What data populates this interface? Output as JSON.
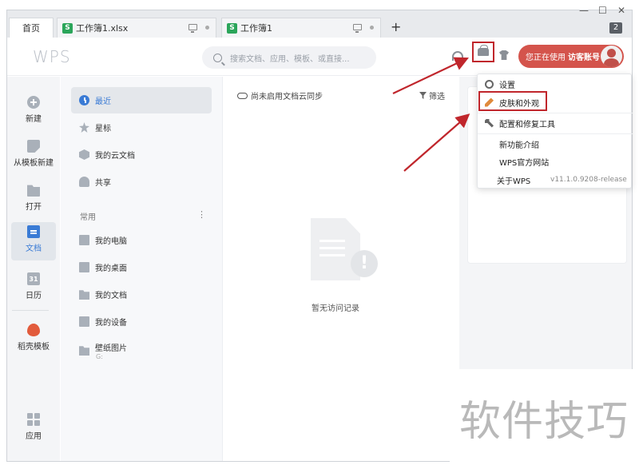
{
  "window": {
    "minimize_glyph": "—",
    "maximize_glyph": "☐",
    "close_glyph": "✕"
  },
  "tabs": [
    {
      "label": "首页",
      "active": true
    },
    {
      "label": "工作簿1.xlsx",
      "icon": "S"
    },
    {
      "label": "工作簿1",
      "icon": "S"
    }
  ],
  "new_tab": "+",
  "tab_count": "2",
  "header": {
    "logo": "WPS",
    "search_placeholder": "搜索文档、应用、模板、或直接...",
    "user_status": "您正在使用",
    "user_name": "访客账号"
  },
  "rail": [
    {
      "label": "新建",
      "icon": "plus-icon"
    },
    {
      "label": "从模板新建",
      "icon": "template-icon"
    },
    {
      "label": "打开",
      "icon": "folder-icon"
    },
    {
      "label": "文档",
      "icon": "document-icon",
      "active": true
    },
    {
      "label": "日历",
      "icon": "calendar-icon",
      "glyph": "31"
    },
    {
      "label": "稻壳模板",
      "icon": "docer-icon"
    },
    {
      "label": "应用",
      "icon": "apps-icon"
    }
  ],
  "nav": {
    "items": [
      {
        "label": "最近",
        "active": true
      },
      {
        "label": "星标"
      },
      {
        "label": "我的云文档"
      },
      {
        "label": "共享"
      }
    ],
    "section": "常用",
    "more": "⋮",
    "locations": [
      {
        "label": "我的电脑"
      },
      {
        "label": "我的桌面"
      },
      {
        "label": "我的文档"
      },
      {
        "label": "我的设备"
      },
      {
        "label": "壁纸图片",
        "sub": "G:"
      }
    ]
  },
  "main": {
    "cloud_sync": "尚未启用文档云同步",
    "filter": "筛选",
    "empty_text": "暂无访问记录",
    "empty_glyph": "!"
  },
  "menu": {
    "settings": "设置",
    "skin": "皮肤和外观",
    "repair": "配置和修复工具",
    "whats_new": "新功能介绍",
    "website": "WPS官方网站",
    "about": "关于WPS",
    "version": "v11.1.0.9208-release"
  },
  "watermark": "软件技巧",
  "colors": {
    "accent": "#3a7bd5",
    "user_pill": "#d4544c",
    "highlight": "#c0262c",
    "arrow": "#c0262c"
  }
}
